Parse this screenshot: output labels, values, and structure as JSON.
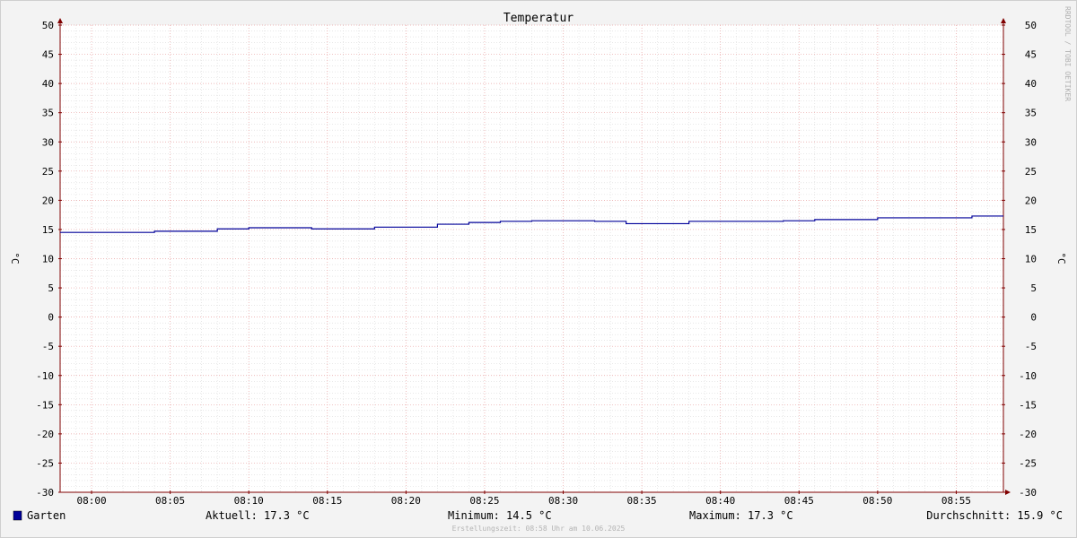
{
  "chart_data": {
    "type": "line",
    "title": "Temperatur",
    "ylabel_left": "°C",
    "ylabel_right": "°C",
    "ylim": [
      -30,
      50
    ],
    "yticks": [
      50,
      45,
      40,
      35,
      30,
      25,
      20,
      15,
      10,
      5,
      0,
      -5,
      -10,
      -15,
      -20,
      -25,
      -30
    ],
    "xlim": [
      "07:58",
      "08:58"
    ],
    "xticks": [
      "08:00",
      "08:05",
      "08:10",
      "08:15",
      "08:20",
      "08:25",
      "08:30",
      "08:35",
      "08:40",
      "08:45",
      "08:50",
      "08:55"
    ],
    "grid": true,
    "series": [
      {
        "name": "Garten",
        "color": "#000099",
        "step": true,
        "points": [
          [
            "07:58",
            14.5
          ],
          [
            "08:04",
            14.7
          ],
          [
            "08:08",
            15.1
          ],
          [
            "08:10",
            15.3
          ],
          [
            "08:14",
            15.1
          ],
          [
            "08:18",
            15.4
          ],
          [
            "08:22",
            15.9
          ],
          [
            "08:24",
            16.2
          ],
          [
            "08:26",
            16.4
          ],
          [
            "08:28",
            16.5
          ],
          [
            "08:32",
            16.4
          ],
          [
            "08:34",
            16.0
          ],
          [
            "08:38",
            16.4
          ],
          [
            "08:44",
            16.5
          ],
          [
            "08:46",
            16.7
          ],
          [
            "08:50",
            17.0
          ],
          [
            "08:56",
            17.3
          ],
          [
            "08:58",
            17.3
          ]
        ]
      }
    ],
    "watermark": "RRDTOOL / TOBI OETIKER",
    "legend": {
      "name": "Garten",
      "current": "Aktuell: 17.3 °C",
      "minimum": "Minimum: 14.5 °C",
      "maximum": "Maximum: 17.3 °C",
      "average": "Durchschnitt: 15.9 °C"
    },
    "footer": "Erstellungszeit: 08:58 Uhr am 10.06.2025",
    "colors": {
      "background": "#f3f3f3",
      "canvas": "#ffffff",
      "grid_minor": "#c8c8c8",
      "grid_major": "#e8a0a0",
      "axis": "#800000"
    }
  }
}
